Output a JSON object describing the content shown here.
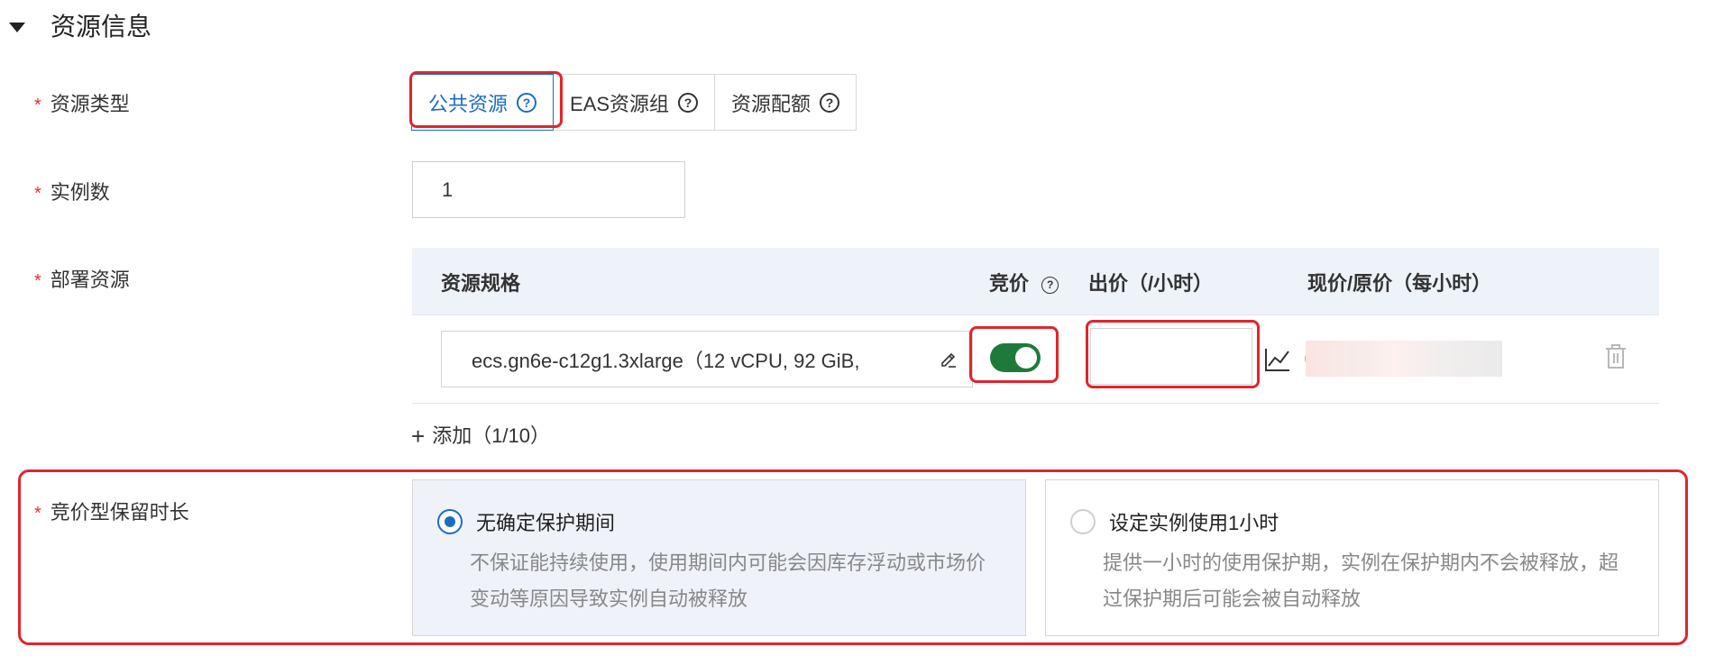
{
  "section": {
    "title": "资源信息"
  },
  "form": {
    "required_mark": "*",
    "resource_type_label": "资源类型",
    "instance_count_label": "实例数",
    "deploy_resource_label": "部署资源",
    "spot_retention_label": "竞价型保留时长"
  },
  "resource_type_tabs": [
    {
      "label": "公共资源",
      "active": true
    },
    {
      "label": "EAS资源组",
      "active": false
    },
    {
      "label": "资源配额",
      "active": false
    }
  ],
  "help_icon_glyph": "?",
  "instance_count": {
    "value": "1"
  },
  "resource_table": {
    "headers": {
      "spec": "资源规格",
      "bidding": "竞价",
      "bid_price": "出价（/小时）",
      "current_price": "现价/原价（每小时）"
    },
    "row": {
      "spec_value": "ecs.gn6e-c12g1.3xlarge（12 vCPU, 92 GiB,",
      "bidding_enabled": true,
      "bid_price_value": ""
    }
  },
  "add_button": {
    "icon": "+",
    "label": "添加（1/10）"
  },
  "retention_options": [
    {
      "title": "无确定保护期间",
      "desc": "不保证能持续使用，使用期间内可能会因库存浮动或市场价变动等原因导致实例自动被释放",
      "selected": true
    },
    {
      "title": "设定实例使用1小时",
      "desc": "提供一小时的使用保护期，实例在保护期内不会被释放，超过保护期后可能会被自动释放",
      "selected": false
    }
  ],
  "colors": {
    "accent": "#1b6dc4",
    "toggle_on": "#1d7a3b",
    "required": "#e0332b",
    "highlight": "#e0252d"
  }
}
